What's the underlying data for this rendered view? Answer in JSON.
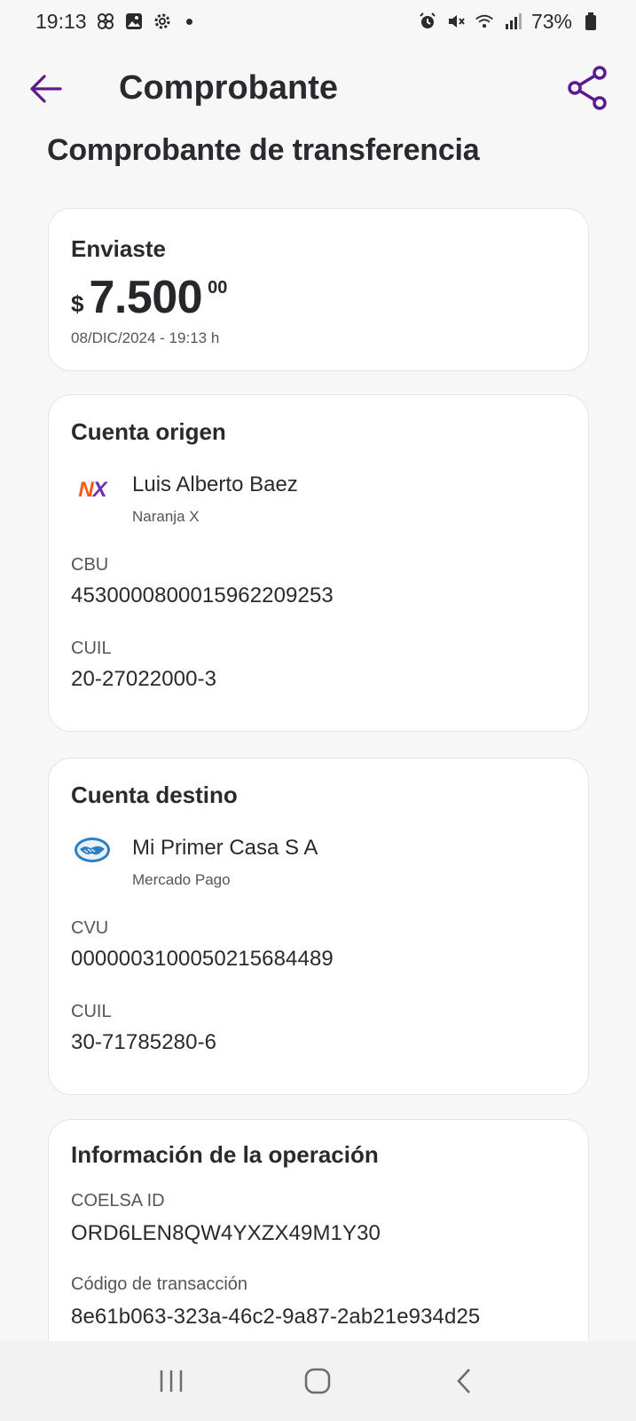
{
  "status_bar": {
    "time": "19:13",
    "battery": "73%",
    "icons": [
      "pinwheel-icon",
      "gallery-icon",
      "settings-icon",
      "dot-icon",
      "alarm-icon",
      "mute-icon",
      "wifi-icon",
      "signal-icon",
      "battery-icon"
    ]
  },
  "header": {
    "title": "Comprobante",
    "back_icon": "arrow-left-icon",
    "share_icon": "share-icon",
    "accent_color": "#5c1a8f"
  },
  "page_title": "Comprobante de transferencia",
  "amount_card": {
    "label": "Enviaste",
    "currency": "$",
    "amount_integer": "7.500",
    "amount_decimal": "00",
    "datetime": "08/DIC/2024 - 19:13 h"
  },
  "origin": {
    "heading": "Cuenta origen",
    "name": "Luis Alberto Baez",
    "bank": "Naranja X",
    "logo_text_n": "N",
    "logo_text_x": "X",
    "id_label": "CBU",
    "id_value": "4530000800015962209253",
    "cuil_label": "CUIL",
    "cuil_value": "20-27022000-3"
  },
  "destination": {
    "heading": "Cuenta destino",
    "name": "Mi Primer Casa S A",
    "bank": "Mercado Pago",
    "logo_icon": "handshake-icon",
    "id_label": "CVU",
    "id_value": "0000003100050215684489",
    "cuil_label": "CUIL",
    "cuil_value": "30-71785280-6"
  },
  "operation": {
    "heading": "Información de la operación",
    "coelsa_label": "COELSA ID",
    "coelsa_value": "ORD6LEN8QW4YXZX49M1Y30",
    "tx_label": "Código de transacción",
    "tx_value": "8e61b063-323a-46c2-9a87-2ab21e934d25"
  },
  "nav_bar": {
    "buttons": [
      "recents-icon",
      "home-icon",
      "back-icon"
    ]
  }
}
